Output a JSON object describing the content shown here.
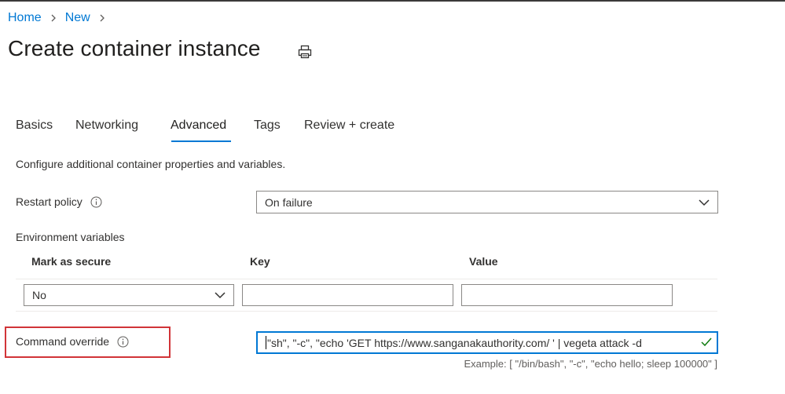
{
  "breadcrumb": {
    "items": [
      "Home",
      "New"
    ]
  },
  "page": {
    "title": "Create container instance"
  },
  "icons": {
    "print": "print-icon",
    "info": "info-icon",
    "chevron": "chevron-right-icon",
    "caret": "chevron-down-icon",
    "check": "checkmark-icon"
  },
  "tabs": [
    "Basics",
    "Networking",
    "Advanced",
    "Tags",
    "Review + create"
  ],
  "active_tab": "Advanced",
  "description": "Configure additional container properties and variables.",
  "restart_policy": {
    "label": "Restart policy",
    "value": "On failure"
  },
  "env": {
    "label": "Environment variables",
    "columns": {
      "secure": "Mark as secure",
      "key": "Key",
      "value": "Value"
    },
    "row": {
      "secure": "No",
      "key": "",
      "value": ""
    }
  },
  "command_override": {
    "label": "Command override",
    "value": "\"sh\", \"-c\", \"echo 'GET https://www.sanganakauthority.com/ ' | vegeta attack -d",
    "example": "Example: [ \"/bin/bash\", \"-c\", \"echo hello; sleep 100000\" ]"
  },
  "colors": {
    "accent": "#0078d4",
    "highlight": "#d13438",
    "text": "#323130",
    "border": "#8a8886"
  }
}
